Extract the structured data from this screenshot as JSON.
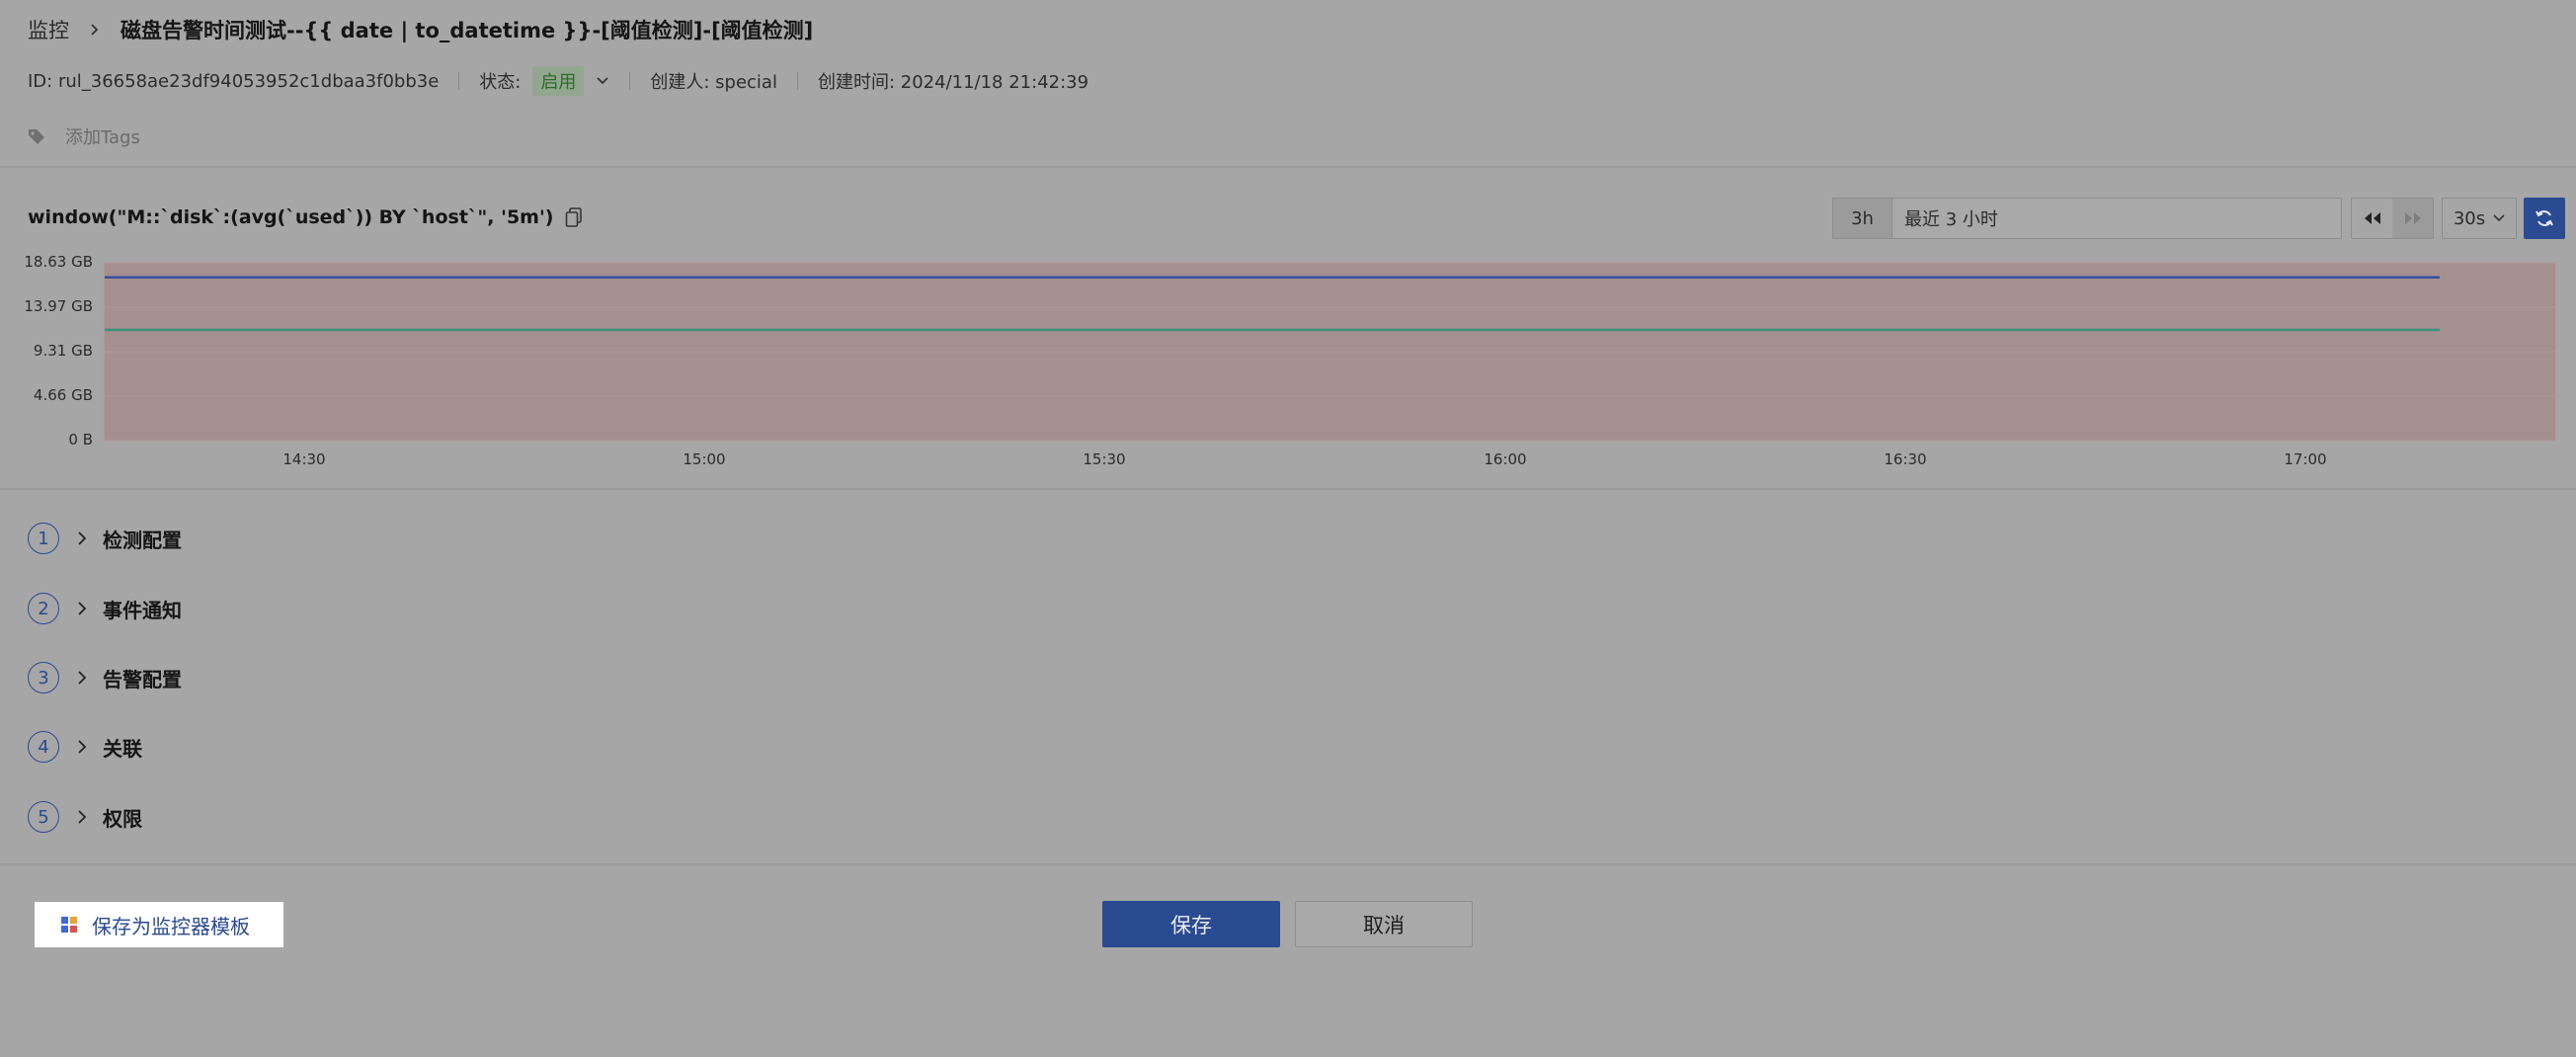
{
  "breadcrumb": {
    "root": "监控",
    "title": "磁盘告警时间测试--{{ date | to_datetime }}-[阈值检测]-[阈值检测]"
  },
  "meta": {
    "id": "ID: rul_36658ae23df94053952c1dbaa3f0bb3e",
    "status_label": "状态:",
    "status_value": "启用",
    "creator": "创建人: special",
    "created_time": "创建时间: 2024/11/18 21:42:39"
  },
  "tags": {
    "placeholder": "添加Tags"
  },
  "query": {
    "text": "window(\"M::`disk`:(avg(`used`)) BY `host`\", '5m')"
  },
  "time_controls": {
    "preset": "3h",
    "range": "最近 3 小时",
    "refresh_interval": "30s"
  },
  "sections": [
    {
      "num": "1",
      "label": "检测配置"
    },
    {
      "num": "2",
      "label": "事件通知"
    },
    {
      "num": "3",
      "label": "告警配置"
    },
    {
      "num": "4",
      "label": "关联"
    },
    {
      "num": "5",
      "label": "权限"
    }
  ],
  "footer": {
    "template_label": "保存为监控器模板",
    "save_label": "保存",
    "cancel_label": "取消"
  },
  "colors": {
    "accent": "#2a4a91",
    "series_1": "#3c4fa0",
    "series_2": "#3e8f78",
    "threshold_fill": "#a59090"
  },
  "chart_data": {
    "type": "line",
    "y_ticks": [
      "18.63 GB",
      "13.97 GB",
      "9.31 GB",
      "4.66 GB",
      "0 B"
    ],
    "x_ticks": [
      "14:30",
      "15:00",
      "15:30",
      "16:00",
      "16:30",
      "17:00"
    ],
    "ylim": [
      0,
      18.63
    ],
    "series": [
      {
        "values": [
          17.1,
          17.1
        ]
      },
      {
        "values": [
          11.6,
          11.6
        ]
      }
    ]
  }
}
